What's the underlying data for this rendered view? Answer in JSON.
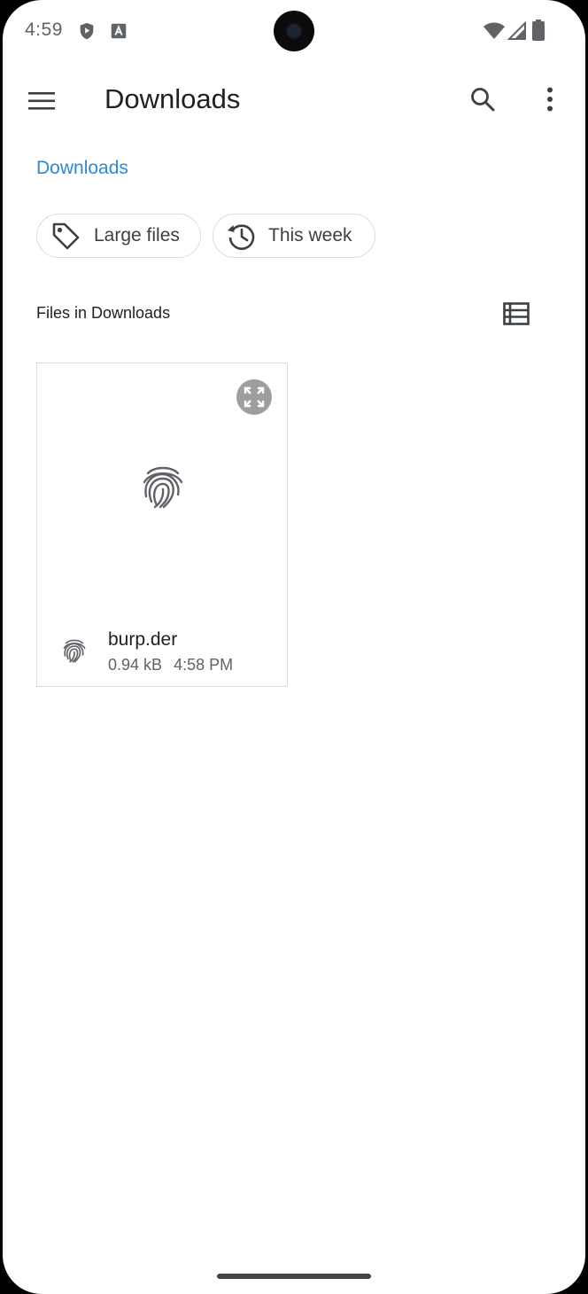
{
  "status_bar": {
    "time": "4:59",
    "left_icons": [
      "shield-play-icon",
      "font-a-icon"
    ],
    "right_icons": [
      "wifi-icon",
      "cell-signal-icon",
      "battery-icon"
    ]
  },
  "toolbar": {
    "title": "Downloads",
    "menu_icon": "hamburger-menu-icon",
    "search_icon": "search-icon",
    "more_icon": "more-vert-icon"
  },
  "breadcrumb": {
    "label": "Downloads"
  },
  "chips": [
    {
      "label": "Large files",
      "icon": "label-tag-icon"
    },
    {
      "label": "This week",
      "icon": "history-icon"
    }
  ],
  "section": {
    "label": "Files in Downloads",
    "view_toggle_icon": "list-view-icon"
  },
  "files": [
    {
      "name": "burp.der",
      "size": "0.94 kB",
      "time": "4:58 PM",
      "icon": "fingerprint-icon",
      "preview_icon": "expand-preview-icon"
    }
  ],
  "colors": {
    "accent": "#2b8ad9",
    "text_primary": "#202124",
    "text_secondary": "#5f6368",
    "border": "#dadce0"
  }
}
